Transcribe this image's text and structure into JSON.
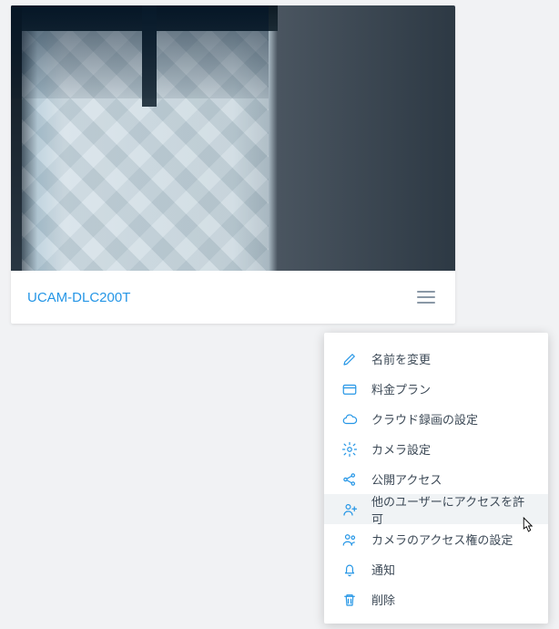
{
  "card": {
    "camera_name": "UCAM-DLC200T"
  },
  "menu": {
    "items": [
      {
        "label": "名前を変更"
      },
      {
        "label": "料金プラン"
      },
      {
        "label": "クラウド録画の設定"
      },
      {
        "label": "カメラ設定"
      },
      {
        "label": "公開アクセス"
      },
      {
        "label": "他のユーザーにアクセスを許可"
      },
      {
        "label": "カメラのアクセス権の設定"
      },
      {
        "label": "通知"
      },
      {
        "label": "削除"
      }
    ]
  }
}
